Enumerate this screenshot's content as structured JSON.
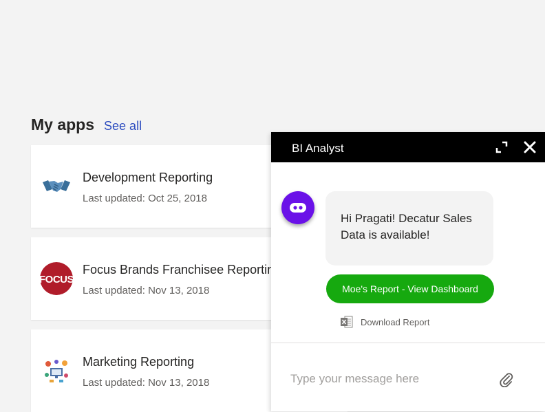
{
  "section": {
    "title": "My apps",
    "see_all": "See all"
  },
  "apps": [
    {
      "name": "Development Reporting",
      "updated": "Last updated: Oct 25, 2018",
      "icon": "handshake-icon"
    },
    {
      "name": "Focus Brands Franchisee Reporting",
      "updated": "Last updated: Nov 13, 2018",
      "icon": "focus-logo",
      "logo_text": "FOCUS"
    },
    {
      "name": "Marketing Reporting",
      "updated": "Last updated: Nov 13, 2018",
      "icon": "marketing-icon"
    }
  ],
  "chat": {
    "title": "BI Analyst",
    "message": "Hi Pragati! Decatur Sales Data is available!",
    "button_label": "Moe's Report - View Dashboard",
    "download_label": "Download Report",
    "input_placeholder": "Type your message here"
  },
  "colors": {
    "accent_link": "#2b4bbf",
    "bot_purple": "#6a11e8",
    "button_green": "#16a90f",
    "header_black": "#000000",
    "focus_red": "#b01c2a"
  }
}
